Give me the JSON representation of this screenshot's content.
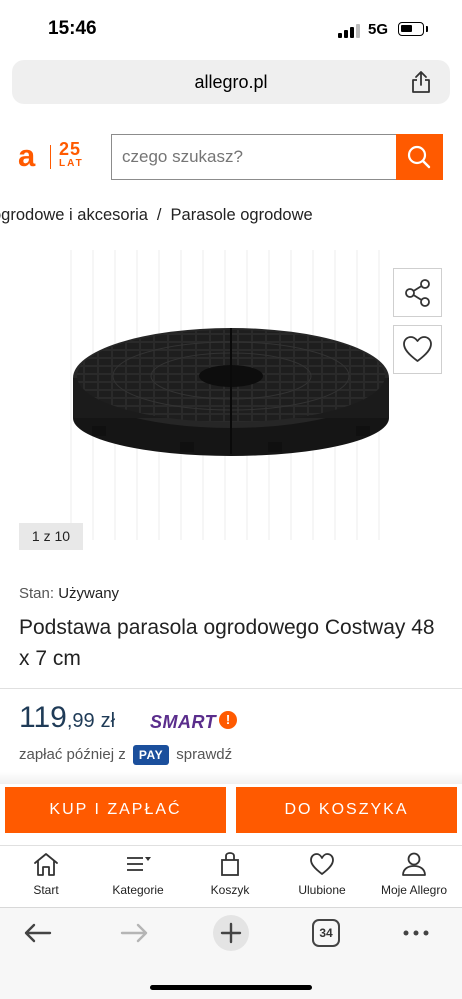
{
  "status": {
    "time": "15:46",
    "network": "5G"
  },
  "browser": {
    "url": "allegro.pl",
    "tabs_count": "34"
  },
  "logo": {
    "letter": "a",
    "years": "25",
    "years_label": "LAT"
  },
  "search": {
    "placeholder": "czego szukasz?"
  },
  "breadcrumb": {
    "items": [
      "ogrodowe i akcesoria",
      "Parasole ogrodowe"
    ],
    "separator": "/"
  },
  "gallery": {
    "counter": "1 z 10"
  },
  "product": {
    "condition_label": "Stan:",
    "condition_value": "Używany",
    "title": "Podstawa parasola ogrodowego Costway 48 x 7 cm",
    "price_int": "119",
    "price_dec": ",99",
    "currency": "zł",
    "smart_label": "SMART"
  },
  "paylater": {
    "prefix": "zapłać później z",
    "badge": "PAY",
    "link": "sprawdź"
  },
  "actions": {
    "buy": "KUP I ZAPŁAĆ",
    "cart": "DO KOSZYKA"
  },
  "tabbar": [
    {
      "label": "Start",
      "icon": "home-icon"
    },
    {
      "label": "Kategorie",
      "icon": "menu-icon"
    },
    {
      "label": "Koszyk",
      "icon": "bag-icon"
    },
    {
      "label": "Ulubione",
      "icon": "heart-icon"
    },
    {
      "label": "Moje Allegro",
      "icon": "user-icon"
    }
  ],
  "colors": {
    "brand": "#ff5a00",
    "price": "#1f3b57",
    "smart": "#5a2d8c",
    "pay": "#1b4f9c"
  }
}
